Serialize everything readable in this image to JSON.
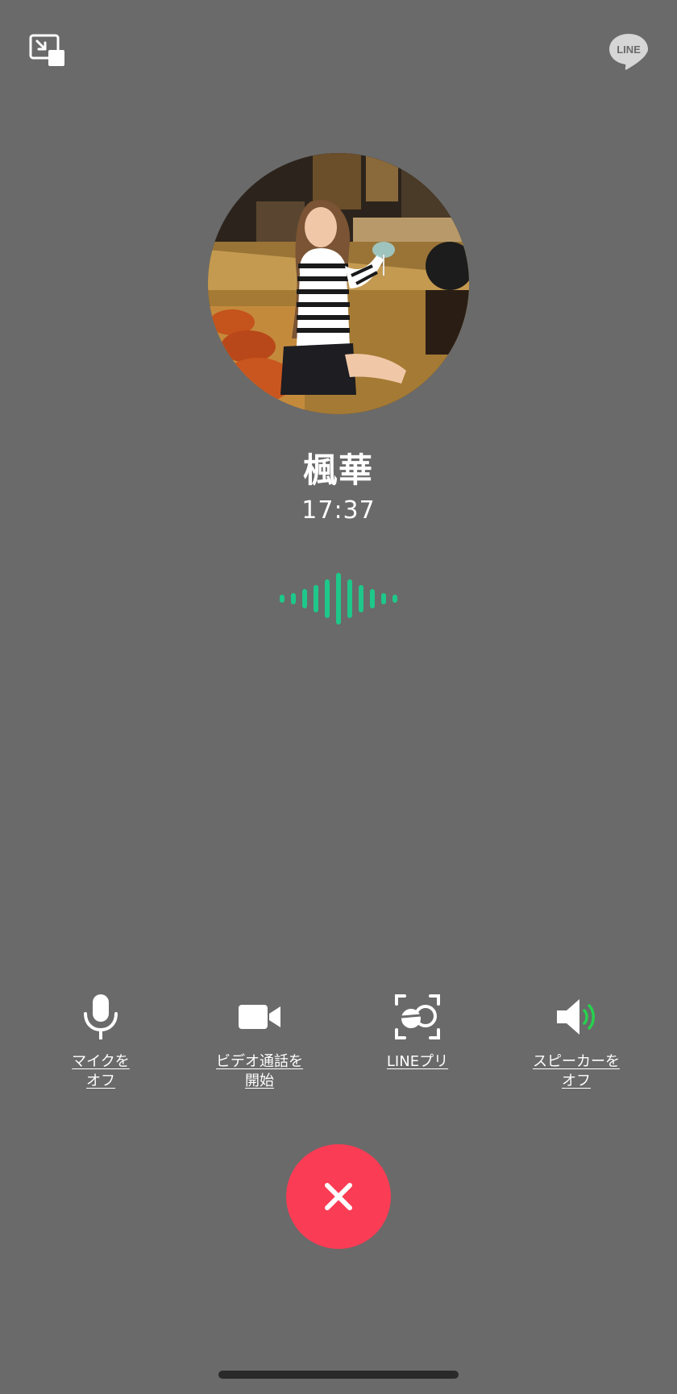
{
  "header": {
    "minimize_icon": "picture-in-picture-icon",
    "logo_text": "LINE"
  },
  "caller": {
    "name": "楓華",
    "call_duration": "17:37"
  },
  "controls": {
    "mic_label": "マイクを\nオフ",
    "video_label": "ビデオ通話を\n開始",
    "filter_label": "LINEプリ",
    "speaker_label": "スピーカーを\nオフ"
  },
  "end_call_icon": "close-icon",
  "colors": {
    "background": "#6a6a6a",
    "accent_green": "#1ec88a",
    "speaker_wave": "#27d14e",
    "end_call": "#fb3c55"
  }
}
